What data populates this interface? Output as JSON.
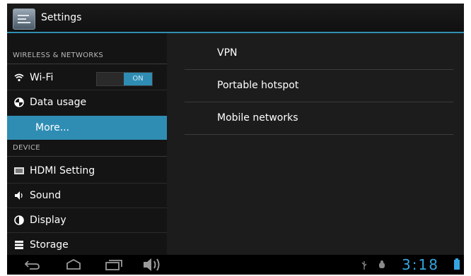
{
  "action_bar": {
    "title": "Settings",
    "icon": "settings-app-icon"
  },
  "left_panel": {
    "section_wireless": "WIRELESS & NETWORKS",
    "wifi": {
      "label": "Wi-Fi",
      "icon": "wifi-icon",
      "toggle": "ON"
    },
    "data_usage": {
      "label": "Data usage",
      "icon": "data-usage-icon"
    },
    "more": {
      "label": "More..."
    },
    "section_device": "DEVICE",
    "hdmi": {
      "label": "HDMI Setting",
      "icon": "hdmi-icon"
    },
    "sound": {
      "label": "Sound",
      "icon": "speaker-icon"
    },
    "display": {
      "label": "Display",
      "icon": "display-icon"
    },
    "storage": {
      "label": "Storage",
      "icon": "storage-icon"
    }
  },
  "right_panel": {
    "items": [
      {
        "label": "VPN"
      },
      {
        "label": "Portable hotspot"
      },
      {
        "label": "Mobile networks"
      }
    ]
  },
  "system_bar": {
    "time": "3:18",
    "icons": [
      "back-icon",
      "home-icon",
      "recent-apps-icon",
      "volume-icon",
      "usb-icon",
      "debug-icon",
      "battery-icon"
    ]
  },
  "colors": {
    "accent": "#2f8db4",
    "clock": "#35a7e0"
  }
}
